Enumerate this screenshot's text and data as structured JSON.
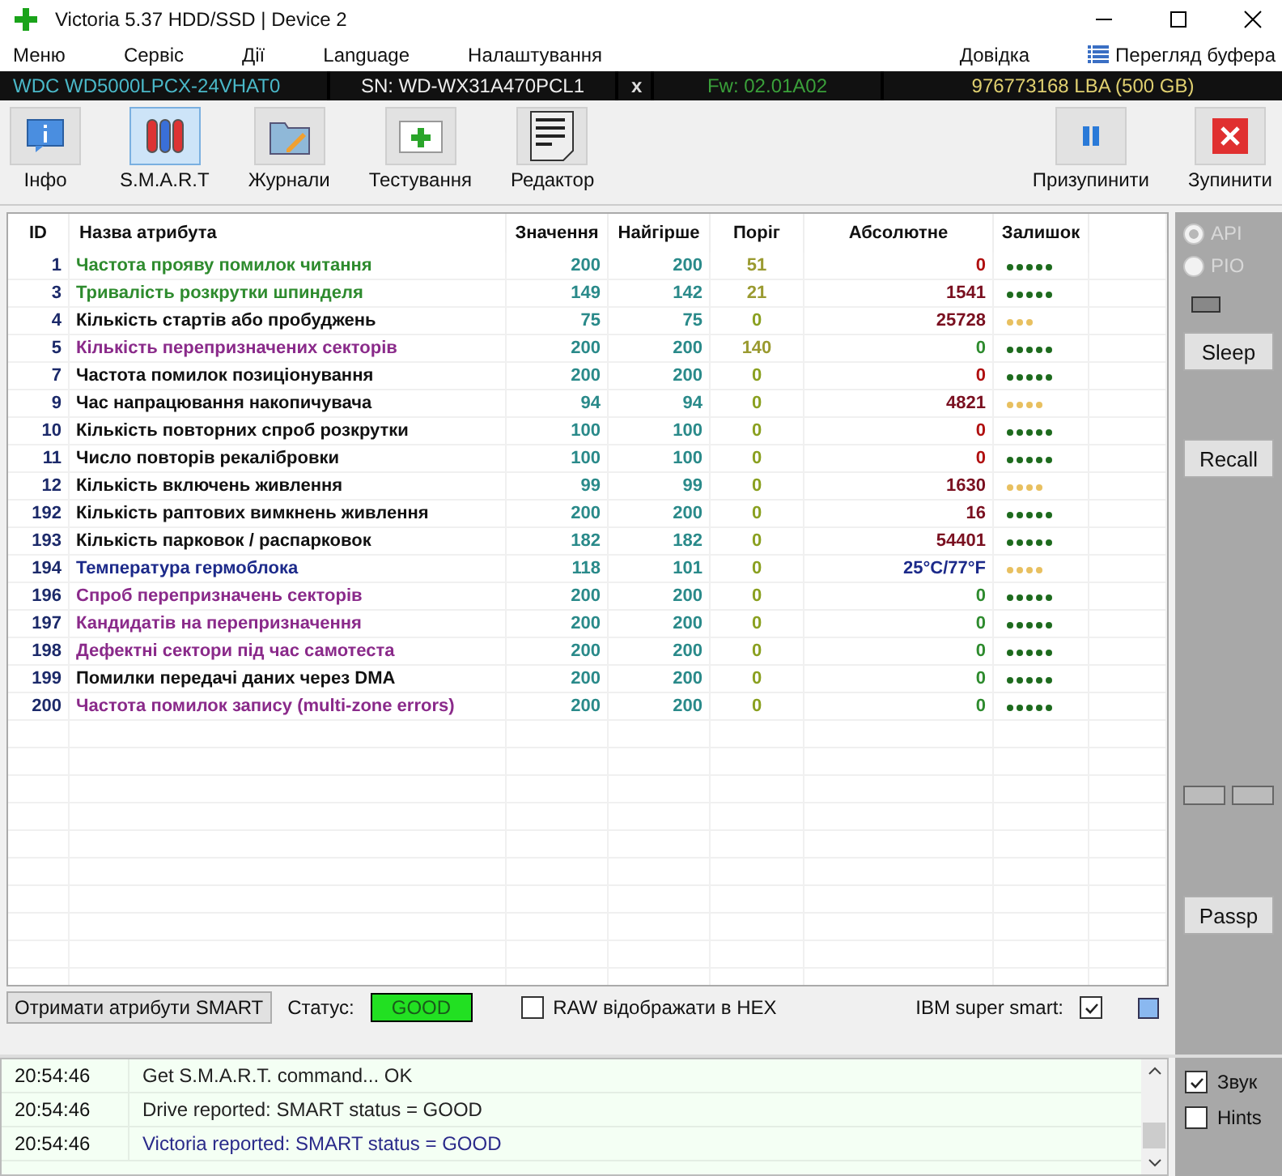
{
  "window": {
    "title": "Victoria 5.37 HDD/SSD | Device 2"
  },
  "menu": [
    "Меню",
    "Сервіс",
    "Дії",
    "Language",
    "Налаштування",
    "Довідка"
  ],
  "clipboard_button": "Перегляд буфера",
  "drive_bar": {
    "model": "WDC WD5000LPCX-24VHAT0",
    "serial": "SN: WD-WX31A470PCL1",
    "close": "x",
    "firmware": "Fw: 02.01A02",
    "capacity": "976773168 LBA (500 GB)"
  },
  "toolbar": [
    {
      "kind": "info",
      "label": "Інфо",
      "selected": false
    },
    {
      "kind": "smart",
      "label": "S.M.A.R.T",
      "selected": true
    },
    {
      "kind": "logs",
      "label": "Журнали",
      "selected": false
    },
    {
      "kind": "test",
      "label": "Тестування",
      "selected": false
    },
    {
      "kind": "editor",
      "label": "Редактор",
      "selected": false
    }
  ],
  "toolbar_right": [
    {
      "kind": "pause",
      "label": "Призупинити"
    },
    {
      "kind": "stop",
      "label": "Зупинити"
    }
  ],
  "table": {
    "columns": [
      "ID",
      "Назва атрибута",
      "Значення",
      "Найгірше",
      "Поріг",
      "Абсолютне",
      "Залишок"
    ],
    "rows": [
      {
        "id": "1",
        "name": "Частота прояву помилок читання",
        "color": "#2e8b2e",
        "value": "200",
        "worst": "200",
        "threshold": {
          "text": "51",
          "color": "#9a9a30"
        },
        "raw": {
          "text": "0",
          "color": "#b01010"
        },
        "health": {
          "stars": 5,
          "color": "#1e6b1e"
        }
      },
      {
        "id": "3",
        "name": "Тривалість розкрутки шпинделя",
        "color": "#2e8b2e",
        "value": "149",
        "worst": "142",
        "threshold": {
          "text": "21",
          "color": "#9a9a30"
        },
        "raw": {
          "text": "1541",
          "color": "#7a1020"
        },
        "health": {
          "stars": 5,
          "color": "#1e6b1e"
        }
      },
      {
        "id": "4",
        "name": "Кількість стартів або пробуджень",
        "color": "#111111",
        "value": "75",
        "worst": "75",
        "threshold": {
          "text": "0",
          "color": "#8aa020"
        },
        "raw": {
          "text": "25728",
          "color": "#7a1020"
        },
        "health": {
          "stars": 3,
          "color": "#e8c060"
        }
      },
      {
        "id": "5",
        "name": "Кількість перепризначених секторів",
        "color": "#8a2a8a",
        "value": "200",
        "worst": "200",
        "threshold": {
          "text": "140",
          "color": "#9a9a30"
        },
        "raw": {
          "text": "0",
          "color": "#2e8b2e"
        },
        "health": {
          "stars": 5,
          "color": "#1e6b1e"
        }
      },
      {
        "id": "7",
        "name": "Частота помилок позиціонування",
        "color": "#111111",
        "value": "200",
        "worst": "200",
        "threshold": {
          "text": "0",
          "color": "#8aa020"
        },
        "raw": {
          "text": "0",
          "color": "#b01010"
        },
        "health": {
          "stars": 5,
          "color": "#1e6b1e"
        }
      },
      {
        "id": "9",
        "name": "Час напрацювання накопичувача",
        "color": "#111111",
        "value": "94",
        "worst": "94",
        "threshold": {
          "text": "0",
          "color": "#8aa020"
        },
        "raw": {
          "text": "4821",
          "color": "#7a1020"
        },
        "health": {
          "stars": 4,
          "color": "#e8c060"
        }
      },
      {
        "id": "10",
        "name": "Кількість повторних спроб розкрутки",
        "color": "#111111",
        "value": "100",
        "worst": "100",
        "threshold": {
          "text": "0",
          "color": "#8aa020"
        },
        "raw": {
          "text": "0",
          "color": "#b01010"
        },
        "health": {
          "stars": 5,
          "color": "#1e6b1e"
        }
      },
      {
        "id": "11",
        "name": "Число повторів рекалібровки",
        "color": "#111111",
        "value": "100",
        "worst": "100",
        "threshold": {
          "text": "0",
          "color": "#8aa020"
        },
        "raw": {
          "text": "0",
          "color": "#b01010"
        },
        "health": {
          "stars": 5,
          "color": "#1e6b1e"
        }
      },
      {
        "id": "12",
        "name": "Кількість включень живлення",
        "color": "#111111",
        "value": "99",
        "worst": "99",
        "threshold": {
          "text": "0",
          "color": "#8aa020"
        },
        "raw": {
          "text": "1630",
          "color": "#7a1020"
        },
        "health": {
          "stars": 4,
          "color": "#e8c060"
        }
      },
      {
        "id": "192",
        "name": "Кількість раптових вимкнень живлення",
        "color": "#111111",
        "value": "200",
        "worst": "200",
        "threshold": {
          "text": "0",
          "color": "#8aa020"
        },
        "raw": {
          "text": "16",
          "color": "#7a1020"
        },
        "health": {
          "stars": 5,
          "color": "#1e6b1e"
        }
      },
      {
        "id": "193",
        "name": "Кількість парковок / распарковок",
        "color": "#111111",
        "value": "182",
        "worst": "182",
        "threshold": {
          "text": "0",
          "color": "#8aa020"
        },
        "raw": {
          "text": "54401",
          "color": "#7a1020"
        },
        "health": {
          "stars": 5,
          "color": "#1e6b1e"
        }
      },
      {
        "id": "194",
        "name": "Температура гермоблока",
        "color": "#1c2a8a",
        "value": "118",
        "worst": "101",
        "threshold": {
          "text": "0",
          "color": "#8aa020"
        },
        "raw": {
          "text": "25°C/77°F",
          "color": "#1c2a8a"
        },
        "health": {
          "stars": 4,
          "color": "#e8c060"
        }
      },
      {
        "id": "196",
        "name": "Спроб перепризначень секторів",
        "color": "#8a2a8a",
        "value": "200",
        "worst": "200",
        "threshold": {
          "text": "0",
          "color": "#8aa020"
        },
        "raw": {
          "text": "0",
          "color": "#2e8b2e"
        },
        "health": {
          "stars": 5,
          "color": "#1e6b1e"
        }
      },
      {
        "id": "197",
        "name": "Кандидатів на перепризначення",
        "color": "#8a2a8a",
        "value": "200",
        "worst": "200",
        "threshold": {
          "text": "0",
          "color": "#8aa020"
        },
        "raw": {
          "text": "0",
          "color": "#2e8b2e"
        },
        "health": {
          "stars": 5,
          "color": "#1e6b1e"
        }
      },
      {
        "id": "198",
        "name": "Дефектні сектори під час самотеста",
        "color": "#8a2a8a",
        "value": "200",
        "worst": "200",
        "threshold": {
          "text": "0",
          "color": "#8aa020"
        },
        "raw": {
          "text": "0",
          "color": "#2e8b2e"
        },
        "health": {
          "stars": 5,
          "color": "#1e6b1e"
        }
      },
      {
        "id": "199",
        "name": "Помилки передачі даних через DMA",
        "color": "#111111",
        "value": "200",
        "worst": "200",
        "threshold": {
          "text": "0",
          "color": "#8aa020"
        },
        "raw": {
          "text": "0",
          "color": "#2e8b2e"
        },
        "health": {
          "stars": 5,
          "color": "#1e6b1e"
        }
      },
      {
        "id": "200",
        "name": "Частота помилок запису (multi-zone errors)",
        "color": "#8a2a8a",
        "value": "200",
        "worst": "200",
        "threshold": {
          "text": "0",
          "color": "#8aa020"
        },
        "raw": {
          "text": "0",
          "color": "#2e8b2e"
        },
        "health": {
          "stars": 5,
          "color": "#1e6b1e"
        }
      }
    ]
  },
  "status_row": {
    "button": "Отримати атрибути SMART",
    "status_label": "Статус:",
    "status": "GOOD",
    "raw_hex": {
      "label": "RAW відображати в HEX",
      "checked": false
    },
    "ibm_label": "IBM super smart:",
    "ibm_checked": true
  },
  "side_panel": {
    "radios": [
      {
        "label": "API",
        "selected": true,
        "disabled": true
      },
      {
        "label": "PIO",
        "selected": false,
        "disabled": true
      }
    ],
    "buttons": [
      "Sleep",
      "Recall"
    ],
    "bottom_button": "Passp"
  },
  "log": [
    {
      "time": "20:54:46",
      "message": "Get S.M.A.R.T. command... OK",
      "color": "#222222"
    },
    {
      "time": "20:54:46",
      "message": "Drive reported: SMART status = GOOD",
      "color": "#222222"
    },
    {
      "time": "20:54:46",
      "message": "Victoria reported: SMART status = GOOD",
      "color": "#2a2a8a"
    }
  ],
  "options": [
    {
      "label": "Звук",
      "checked": true
    },
    {
      "label": "Hints",
      "checked": false
    }
  ]
}
